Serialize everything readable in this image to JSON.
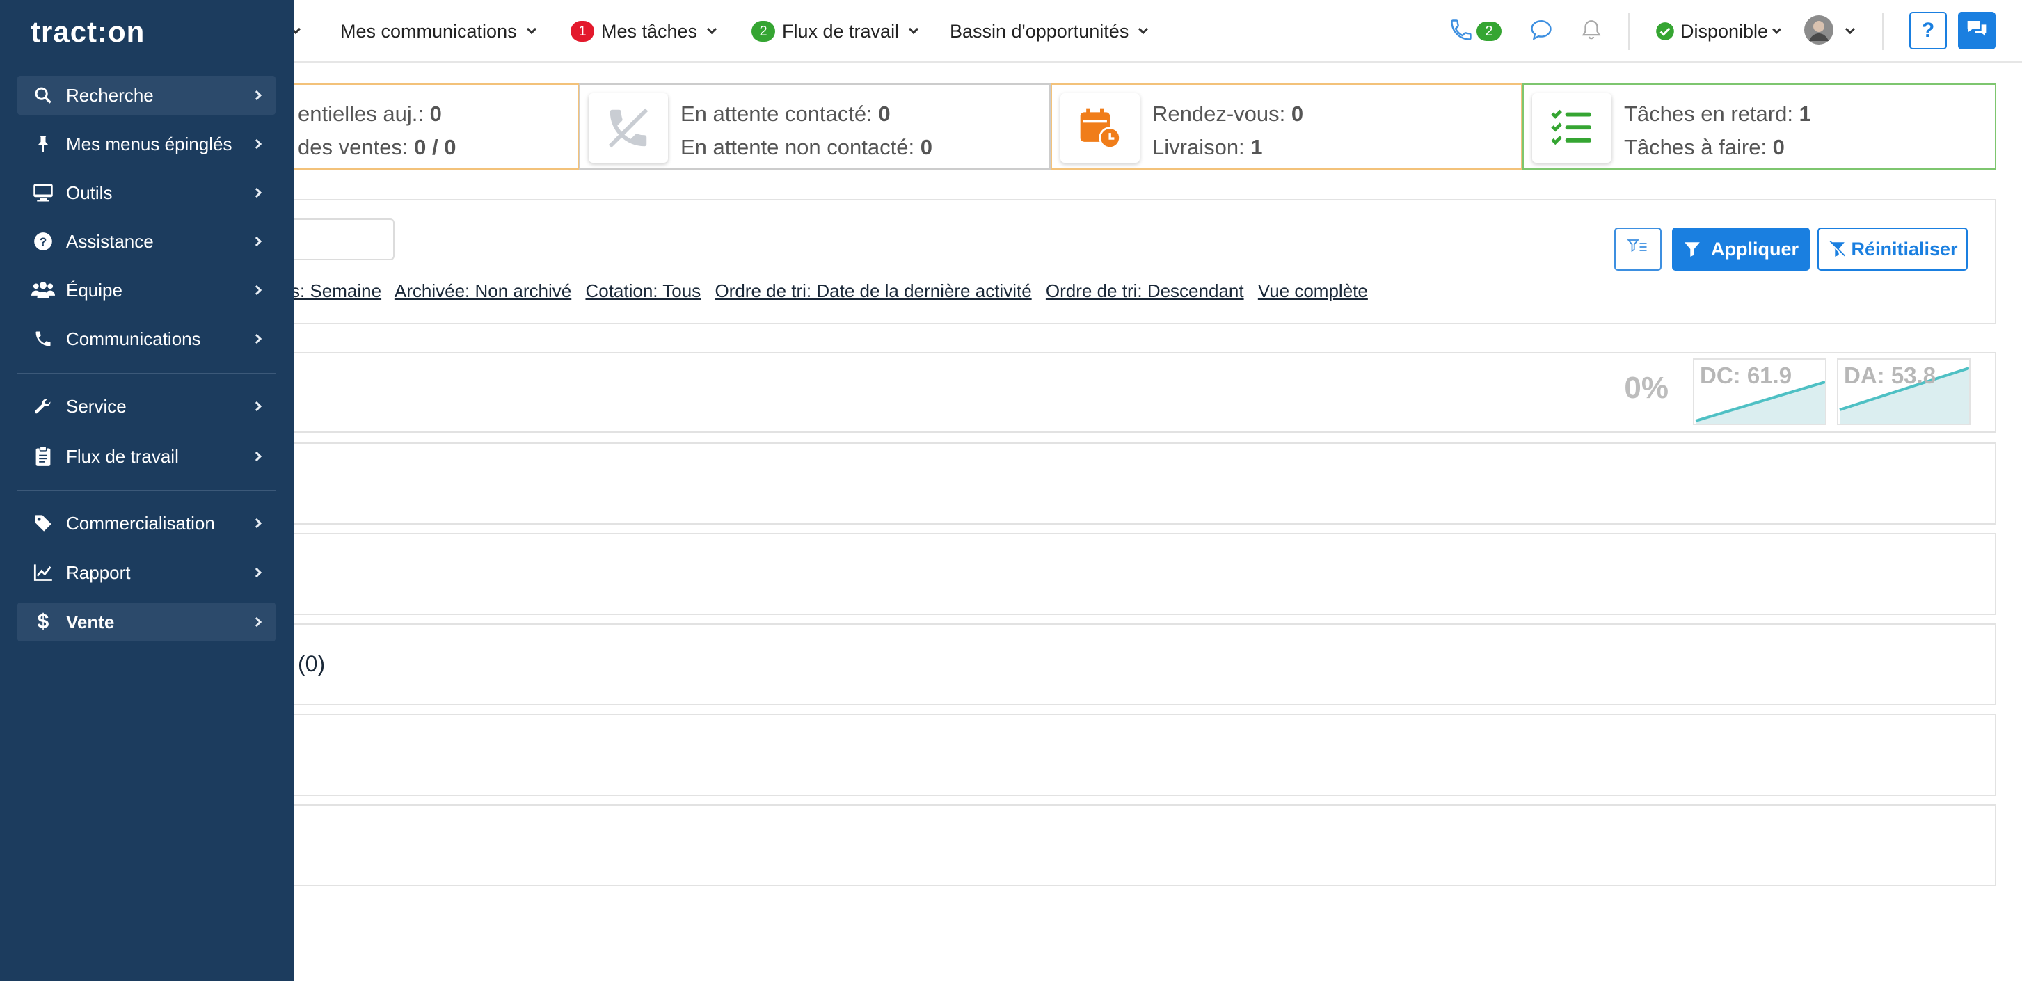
{
  "brand": {
    "logo_text": "tract:on"
  },
  "topbar": {
    "nav": [
      {
        "label": "Mes communications"
      },
      {
        "label": "Mes tâches",
        "badge": "1"
      },
      {
        "label": "Flux de travail",
        "badge": "2"
      },
      {
        "label": "Bassin d'opportunités"
      }
    ],
    "phone_badge": "2",
    "status_label": "Disponible",
    "help_label": "?",
    "colors": {
      "accent": "#1a7fe0",
      "success": "#35a532",
      "danger": "#e3192c"
    }
  },
  "cards": [
    {
      "line1_label": "entielles auj.: ",
      "line1_value": "0",
      "line2_label": "des ventes: ",
      "line2_value": "0 / 0",
      "border": "#f3c27a"
    },
    {
      "line1_label": "En attente contacté: ",
      "line1_value": "0",
      "line2_label": "En attente non contacté: ",
      "line2_value": "0",
      "icon": "phone-slash-icon",
      "border": "#cccccc"
    },
    {
      "line1_label": "Rendez-vous: ",
      "line1_value": "0",
      "line2_label": "Livraison: ",
      "line2_value": "1",
      "icon": "calendar-clock-icon",
      "border": "#f3c27a"
    },
    {
      "line1_label": "Tâches en retard: ",
      "line1_value": "1",
      "line2_label": "Tâches à faire: ",
      "line2_value": "0",
      "icon": "task-list-icon",
      "border": "#7ec66f"
    }
  ],
  "filters": {
    "chips": [
      "s: Semaine",
      "Archivée: Non archivé",
      "Cotation: Tous",
      "Ordre de tri: Date de la dernière activité",
      "Ordre de tri: Descendant",
      "Vue complète"
    ],
    "apply_label": "Appliquer",
    "reset_label": "Réinitialiser"
  },
  "summary": {
    "percent": "0%",
    "sparklines": [
      {
        "label": "DC: 61.9"
      },
      {
        "label": "DA: 53.8"
      }
    ]
  },
  "sections": [
    {
      "label": ""
    },
    {
      "label": ""
    },
    {
      "label": "(0)"
    },
    {
      "label": ""
    },
    {
      "label": ""
    }
  ],
  "sidebar": {
    "items": [
      {
        "label": "Recherche",
        "icon": "search-icon"
      },
      {
        "label": "Mes menus épinglés",
        "icon": "pin-icon"
      },
      {
        "label": "Outils",
        "icon": "monitor-icon"
      },
      {
        "label": "Assistance",
        "icon": "question-circle-icon"
      },
      {
        "label": "Équipe",
        "icon": "users-icon"
      },
      {
        "label": "Communications",
        "icon": "phone-icon"
      },
      {
        "label": "Service",
        "icon": "wrench-icon"
      },
      {
        "label": "Flux de travail",
        "icon": "clipboard-icon"
      },
      {
        "label": "Commercialisation",
        "icon": "tag-icon"
      },
      {
        "label": "Rapport",
        "icon": "chart-line-icon"
      },
      {
        "label": "Vente",
        "icon": "dollar-icon"
      }
    ]
  }
}
